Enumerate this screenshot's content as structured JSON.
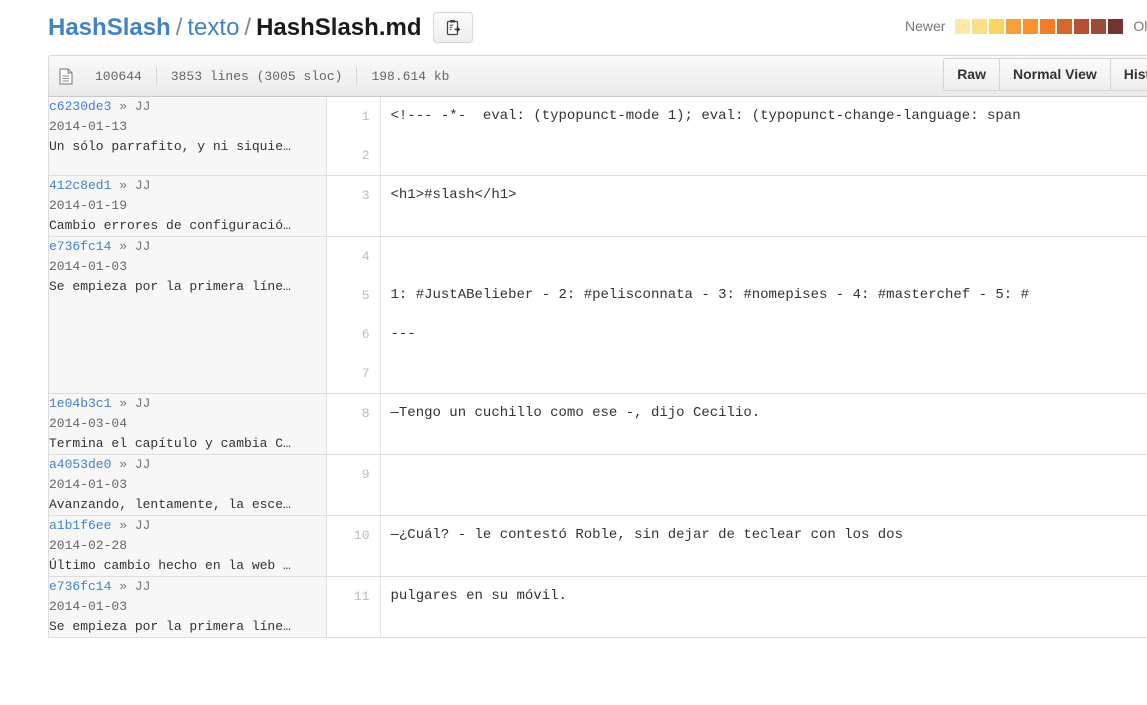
{
  "breadcrumb": {
    "repo": "HashSlash",
    "sep": "/",
    "dir": "texto",
    "file": "HashSlash.md",
    "copy_button_title": "Copy path"
  },
  "age_legend": {
    "newer_label": "Newer",
    "older_label": "Olde",
    "colors": [
      "#fce9a6",
      "#fcdd88",
      "#fdd35f",
      "#f79f3c",
      "#f6922f",
      "#f47c28",
      "#d1692a",
      "#b84e37",
      "#9c4b34",
      "#73342f"
    ]
  },
  "file_meta": {
    "mode": "100644",
    "lines": "3853 lines (3005 sloc)",
    "size": "198.614 kb"
  },
  "view_buttons": [
    {
      "label": "Raw"
    },
    {
      "label": "Normal View"
    },
    {
      "label": "History"
    }
  ],
  "blame": [
    {
      "sha": "c6230de3",
      "arrow": "»",
      "author": "JJ",
      "date": "2014-01-13",
      "message": "Un sólo parrafito, y ni siquie…",
      "lines": [
        {
          "num": "1",
          "code": "<!--- -*-  eval: (typopunct-mode 1); eval: (typopunct-change-language: span"
        },
        {
          "num": "2",
          "code": ""
        }
      ]
    },
    {
      "sha": "412c8ed1",
      "arrow": "»",
      "author": "JJ",
      "date": "2014-01-19",
      "message": "Cambio errores de configuració…",
      "lines": [
        {
          "num": "3",
          "code": "<h1>#slash</h1>"
        }
      ]
    },
    {
      "sha": "e736fc14",
      "arrow": "»",
      "author": "JJ",
      "date": "2014-01-03",
      "message": "Se empieza por la primera líne…",
      "lines": [
        {
          "num": "4",
          "code": ""
        },
        {
          "num": "5",
          "code": "1: #JustABelieber - 2: #pelisconnata - 3: #nomepises - 4: #masterchef - 5: #"
        },
        {
          "num": "6",
          "code": "---"
        },
        {
          "num": "7",
          "code": ""
        }
      ]
    },
    {
      "sha": "1e04b3c1",
      "arrow": "»",
      "author": "JJ",
      "date": "2014-03-04",
      "message": "Termina el capítulo y cambia C…",
      "lines": [
        {
          "num": "8",
          "code": "—Tengo un cuchillo como ese -, dijo Cecilio."
        }
      ]
    },
    {
      "sha": "a4053de0",
      "arrow": "»",
      "author": "JJ",
      "date": "2014-01-03",
      "message": "Avanzando, lentamente, la esce…",
      "lines": [
        {
          "num": "9",
          "code": ""
        }
      ]
    },
    {
      "sha": "a1b1f6ee",
      "arrow": "»",
      "author": "JJ",
      "date": "2014-02-28",
      "message": "Último cambio hecho en la web …",
      "lines": [
        {
          "num": "10",
          "code": "—¿Cuál? - le contestó Roble, sin dejar de teclear con los dos"
        }
      ]
    },
    {
      "sha": "e736fc14",
      "arrow": "»",
      "author": "JJ",
      "date": "2014-01-03",
      "message": "Se empieza por la primera líne…",
      "lines": [
        {
          "num": "11",
          "code": "pulgares en su móvil."
        }
      ]
    }
  ]
}
